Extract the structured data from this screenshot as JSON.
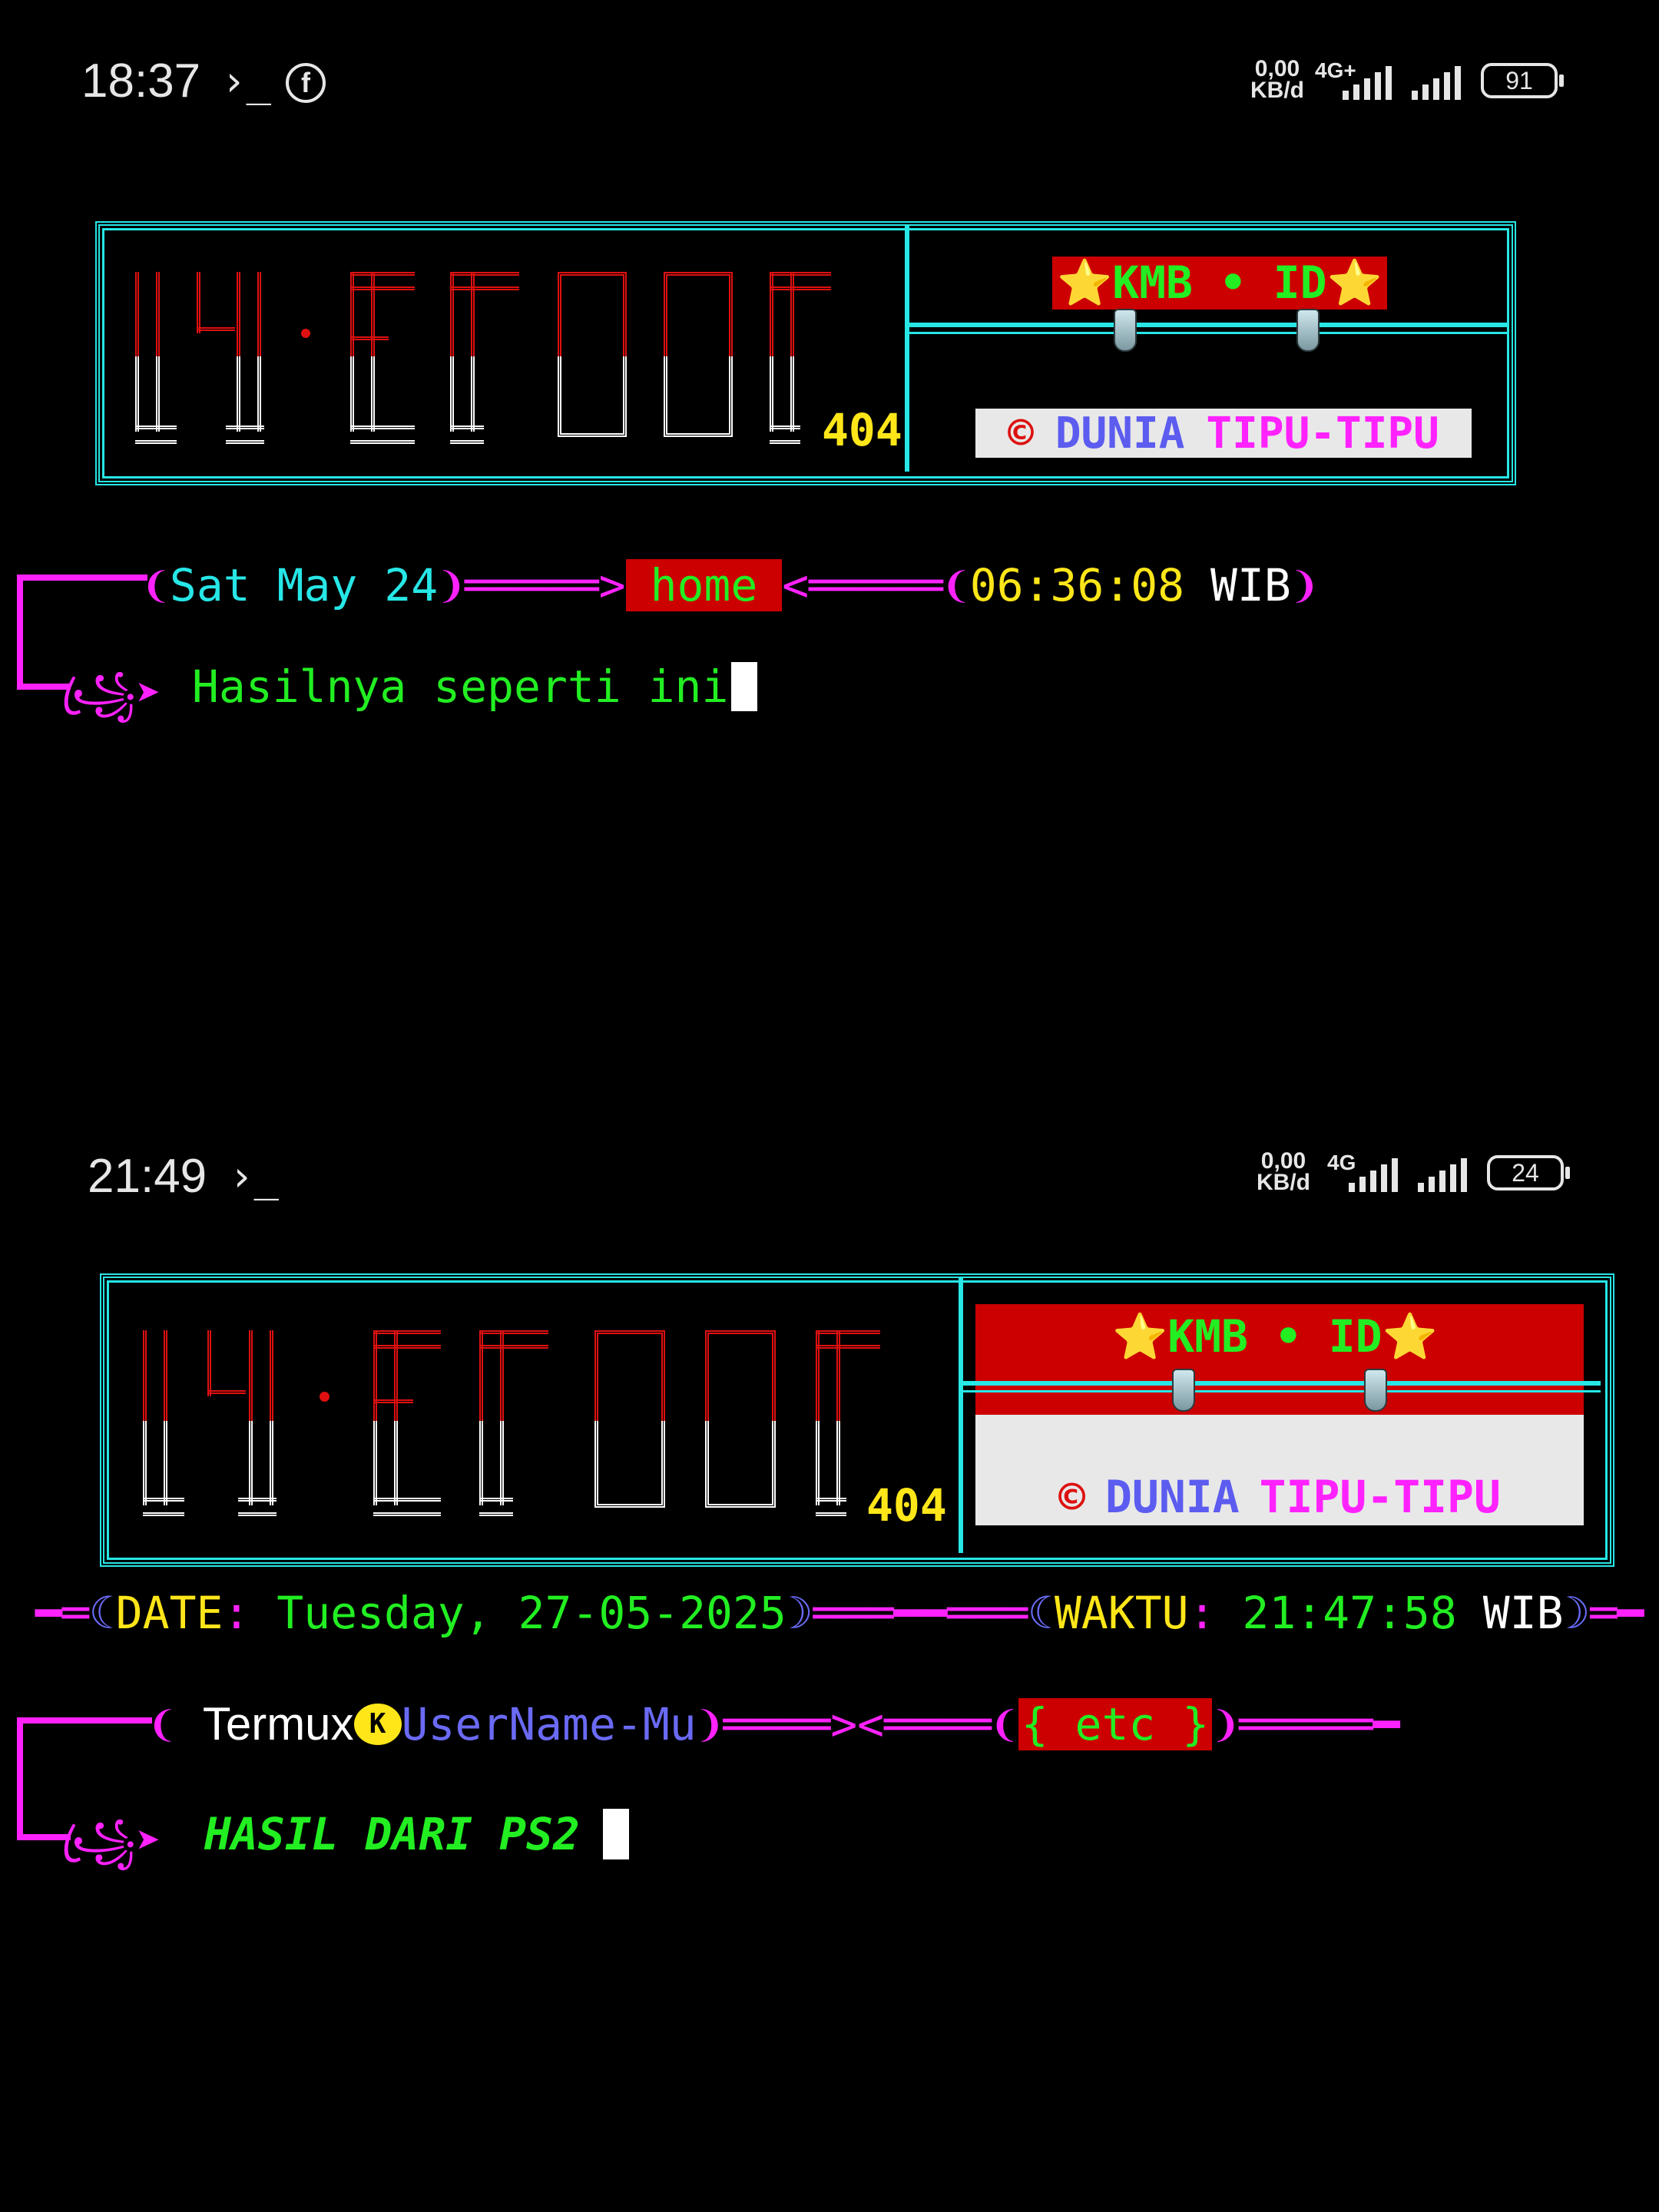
{
  "top": {
    "status": {
      "time": "18:37",
      "terminal_glyph": "›_",
      "fb_glyph": "f",
      "data_rate_value": "0,00",
      "data_rate_unit": "KB/d",
      "network": "4G+",
      "battery": "91"
    },
    "banner": {
      "logo_number": "404",
      "kmb_label": "⭐KMB • ID⭐",
      "copyright": {
        "symbol": "©",
        "word1": "DUNIA",
        "word2": "TIPU-TIPU"
      }
    },
    "prompt": {
      "date": "Sat May 24",
      "page": "home",
      "time": "06:36:08",
      "zone": "WIB",
      "command": "Hasilnya seperti ini"
    }
  },
  "bottom": {
    "status": {
      "time": "21:49",
      "terminal_glyph": "›_",
      "data_rate_value": "0,00",
      "data_rate_unit": "KB/d",
      "network": "4G",
      "battery": "24"
    },
    "banner": {
      "logo_number": "404",
      "kmb_label": "⭐KMB • ID⭐",
      "copyright": {
        "symbol": "©",
        "word1": "DUNIA",
        "word2": "TIPU-TIPU"
      }
    },
    "info": {
      "date_label": "DATE",
      "date_value": "Tuesday, 27-05-2025",
      "time_label": "WAKTU",
      "time_value": "21:47:58",
      "zone": "WIB"
    },
    "prompt": {
      "host": "Termux",
      "user": "UserName-Mu",
      "tag": "{ etc }",
      "command": "HASIL DARI PS2"
    }
  },
  "colors": {
    "cyan": "#27e6e6",
    "magenta": "#ff22ff",
    "green": "#22ee22",
    "yellow": "#ffe619",
    "red": "#cc0000"
  }
}
